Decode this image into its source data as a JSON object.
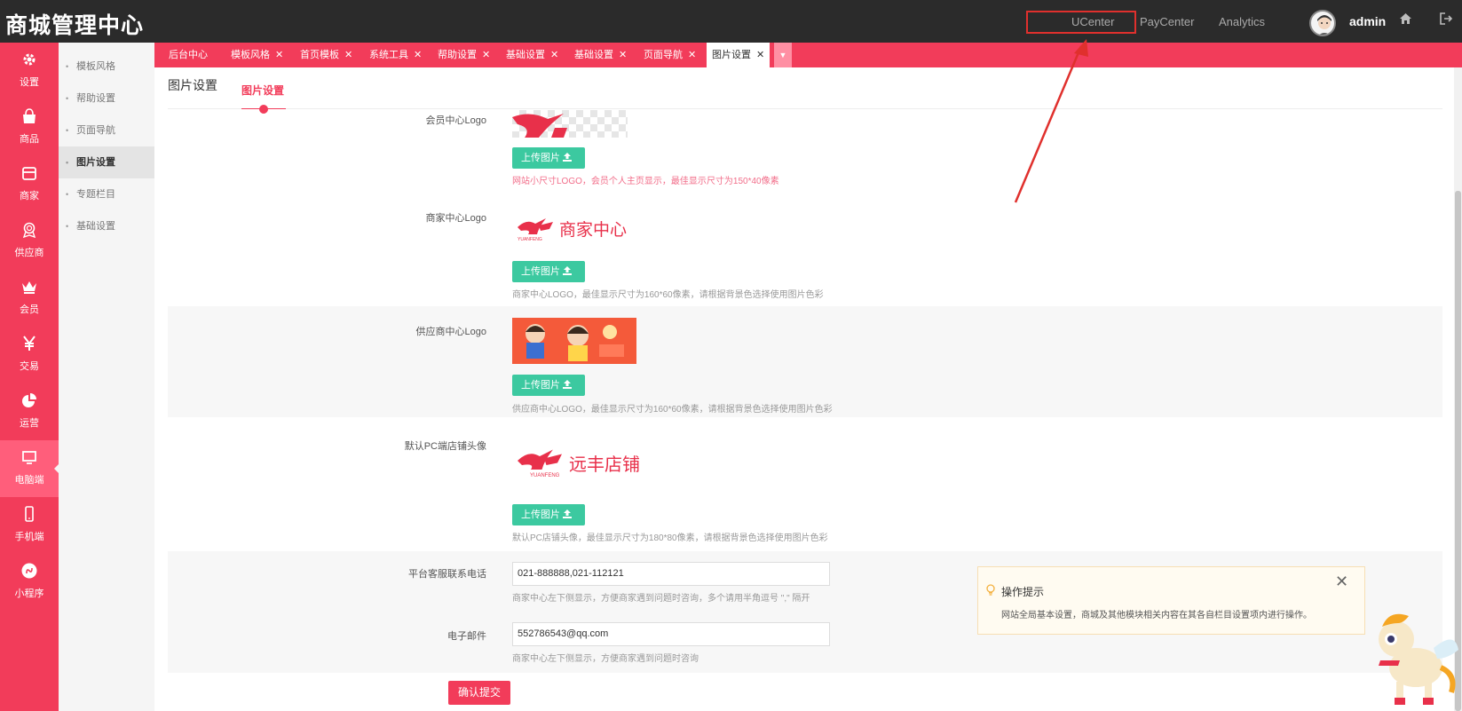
{
  "header": {
    "brand": "商城管理中心",
    "nav": [
      "UCenter",
      "PayCenter",
      "Analytics"
    ],
    "user": "admin",
    "icons": [
      "home-icon",
      "logout-icon"
    ]
  },
  "sidebar": {
    "items": [
      {
        "label": "设置",
        "icon": "gear-icon"
      },
      {
        "label": "商品",
        "icon": "shopping-bag-icon"
      },
      {
        "label": "商家",
        "icon": "store-icon"
      },
      {
        "label": "供应商",
        "icon": "award-icon"
      },
      {
        "label": "会员",
        "icon": "crown-icon"
      },
      {
        "label": "交易",
        "icon": "yen-icon"
      },
      {
        "label": "运营",
        "icon": "pie-chart-icon"
      },
      {
        "label": "电脑端",
        "icon": "monitor-icon",
        "active": true
      },
      {
        "label": "手机端",
        "icon": "phone-icon"
      },
      {
        "label": "小程序",
        "icon": "miniprogram-icon"
      }
    ]
  },
  "submenu": {
    "items": [
      "模板风格",
      "帮助设置",
      "页面导航",
      "图片设置",
      "专题栏目",
      "基础设置"
    ],
    "active": "图片设置"
  },
  "tabs": [
    "后台中心",
    "模板风格",
    "首页模板",
    "系统工具",
    "帮助设置",
    "基础设置",
    "基础设置",
    "页面导航",
    "图片设置"
  ],
  "active_tab": "图片设置",
  "page": {
    "title": "图片设置",
    "subtab": "图片设置"
  },
  "form": {
    "member_logo": {
      "label": "会员中心Logo",
      "upload": "上传图片",
      "help": "网站小尺寸LOGO，会员个人主页显示，最佳显示尺寸为150*40像素"
    },
    "seller_logo": {
      "label": "商家中心Logo",
      "logo_text": "商家中心",
      "logo_sub": "YUANFENG",
      "upload": "上传图片",
      "help": "商家中心LOGO，最佳显示尺寸为160*60像素，请根据背景色选择使用图片色彩"
    },
    "supplier_logo": {
      "label": "供应商中心Logo",
      "upload": "上传图片",
      "help": "供应商中心LOGO，最佳显示尺寸为160*60像素，请根据背景色选择使用图片色彩"
    },
    "store_avatar": {
      "label": "默认PC端店铺头像",
      "logo_text": "远丰店铺",
      "logo_sub": "YUANFENG",
      "upload": "上传图片",
      "help": "默认PC店铺头像，最佳显示尺寸为180*80像素，请根据背景色选择使用图片色彩"
    },
    "phone": {
      "label": "平台客服联系电话",
      "value": "021-888888,021-112121",
      "help": "商家中心左下侧显示，方便商家遇到问题时咨询，多个请用半角逗号 \",\" 隔开"
    },
    "email": {
      "label": "电子邮件",
      "value": "552786543@qq.com",
      "help": "商家中心左下侧显示，方便商家遇到问题时咨询"
    },
    "submit": "确认提交"
  },
  "tips": {
    "title": "操作提示",
    "body": "网站全局基本设置，商城及其他模块相关内容在其各自栏目设置项内进行操作。"
  },
  "colors": {
    "topbar": "#2b2b2b",
    "accent": "#f23c5a",
    "upload": "#3cc9a0",
    "highlight_box": "#e0302d"
  }
}
